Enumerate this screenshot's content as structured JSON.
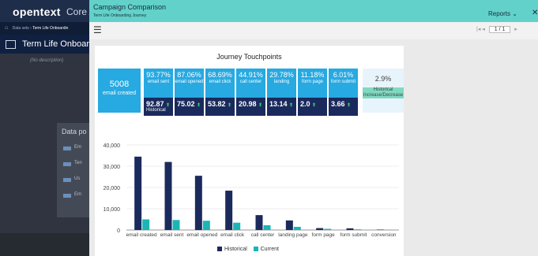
{
  "background": {
    "logo": "opentext",
    "product": "Core A",
    "breadcrumb_root": "Data sets",
    "breadcrumb_current": "Term Life Onboardin",
    "title": "Term Life Onboar",
    "description": "(No description)",
    "panel_heading": "Data po",
    "panel_items": [
      "Em",
      "Ten",
      "Us",
      "Em"
    ]
  },
  "modal": {
    "title": "Campaign Comparison",
    "subtitle": "Term Life Onboarding Journey",
    "reports_label": "Reports",
    "close_glyph": "✕",
    "pager": "1 / 1"
  },
  "report": {
    "title": "Journey Touchpoints",
    "kpi_main": {
      "value": "5008",
      "label": "email created"
    },
    "kpis": [
      {
        "value": "93.77%",
        "label": "email sent",
        "hist": "92.87"
      },
      {
        "value": "87.06%",
        "label": "email opened",
        "hist": "75.02"
      },
      {
        "value": "68.69%",
        "label": "email click",
        "hist": "53.82"
      },
      {
        "value": "44.91%",
        "label": "call center",
        "hist": "20.98"
      },
      {
        "value": "29.78%",
        "label": "landing",
        "hist": "13.14"
      },
      {
        "value": "11.18%",
        "label": "form page",
        "hist": "2.0"
      },
      {
        "value": "6.01%",
        "label": "form submit",
        "hist": "3.66"
      }
    ],
    "hist_label": "Historical",
    "last_kpi": {
      "value": "2.9%",
      "label": "Historical Increase/Decrease"
    }
  },
  "chart_data": {
    "type": "bar",
    "categories": [
      "email created",
      "email sent",
      "email opened",
      "email click",
      "call center",
      "landing page",
      "form page",
      "form submit",
      "conversion"
    ],
    "series": [
      {
        "name": "Historical",
        "values": [
          34500,
          32000,
          25500,
          18500,
          7000,
          4500,
          900,
          800,
          200
        ]
      },
      {
        "name": "Current",
        "values": [
          5008,
          4696,
          4360,
          3440,
          2249,
          1491,
          560,
          301,
          100
        ]
      }
    ],
    "ylim": [
      0,
      40000
    ],
    "yticks": [
      "40,000",
      "30,000",
      "20,000",
      "10,000",
      "0"
    ],
    "colors": {
      "Historical": "#1b2a5c",
      "Current": "#1ab5b5"
    }
  }
}
